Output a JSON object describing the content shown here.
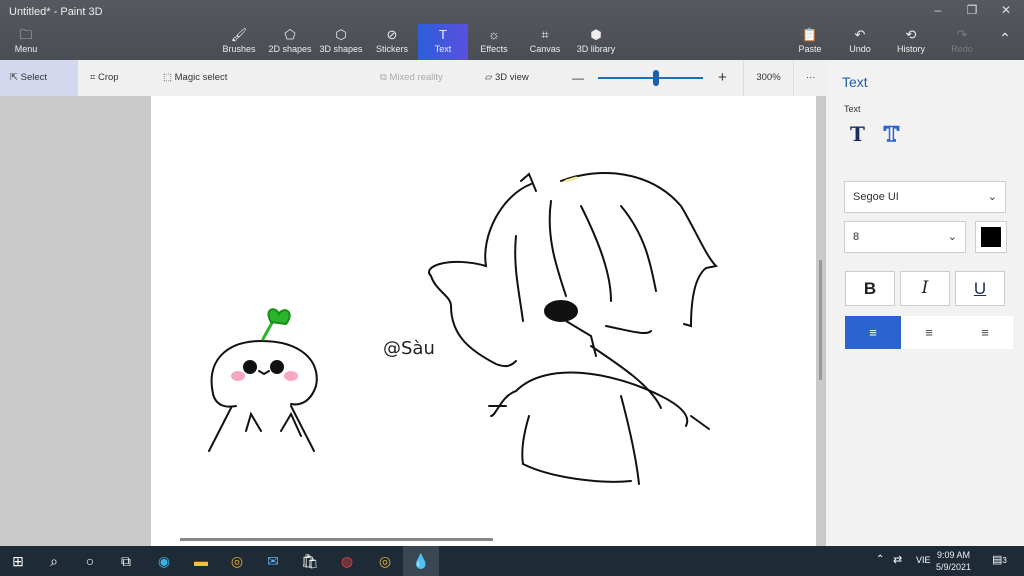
{
  "window": {
    "title": "Untitled* - Paint 3D",
    "minimize": "–",
    "maximize": "❐",
    "close": "✕"
  },
  "ribbon": {
    "menu": {
      "label": "Menu",
      "icon": "🗀"
    },
    "tabs": [
      {
        "label": "Brushes",
        "icon": "🖌"
      },
      {
        "label": "2D shapes",
        "icon": "⬠"
      },
      {
        "label": "3D shapes",
        "icon": "⬡"
      },
      {
        "label": "Stickers",
        "icon": "⊘"
      },
      {
        "label": "Text",
        "icon": "T"
      },
      {
        "label": "Effects",
        "icon": "☼"
      },
      {
        "label": "Canvas",
        "icon": "⌗"
      },
      {
        "label": "3D library",
        "icon": "⬢"
      }
    ],
    "actions": [
      {
        "label": "Paste",
        "icon": "📋"
      },
      {
        "label": "Undo",
        "icon": "↶"
      },
      {
        "label": "History",
        "icon": "⟲"
      },
      {
        "label": "Redo",
        "icon": "↷"
      }
    ],
    "collapse": "⌃"
  },
  "toolbar": {
    "select": "Select",
    "crop": "Crop",
    "magic_select": "Magic select",
    "mixed_reality": "Mixed reality",
    "view3d": "3D view",
    "zoom_out": "—",
    "zoom_in": "+",
    "zoom": "300%",
    "zoom_fraction": 0.55,
    "more": "···"
  },
  "canvas": {
    "text": "@Sàu"
  },
  "panel": {
    "title": "Text",
    "section": "Text",
    "font": "Segoe UI",
    "size": "8",
    "color": "#000000",
    "bold": "B",
    "italic": "I",
    "underline": "U",
    "align_left": "≡",
    "align_center": "≡",
    "align_right": "≡",
    "text2d": "T",
    "text3d": "T"
  },
  "taskbar": {
    "tray_lang": "VIE",
    "time": "9:09 AM",
    "date": "5/9/2021",
    "notifications": "3"
  }
}
